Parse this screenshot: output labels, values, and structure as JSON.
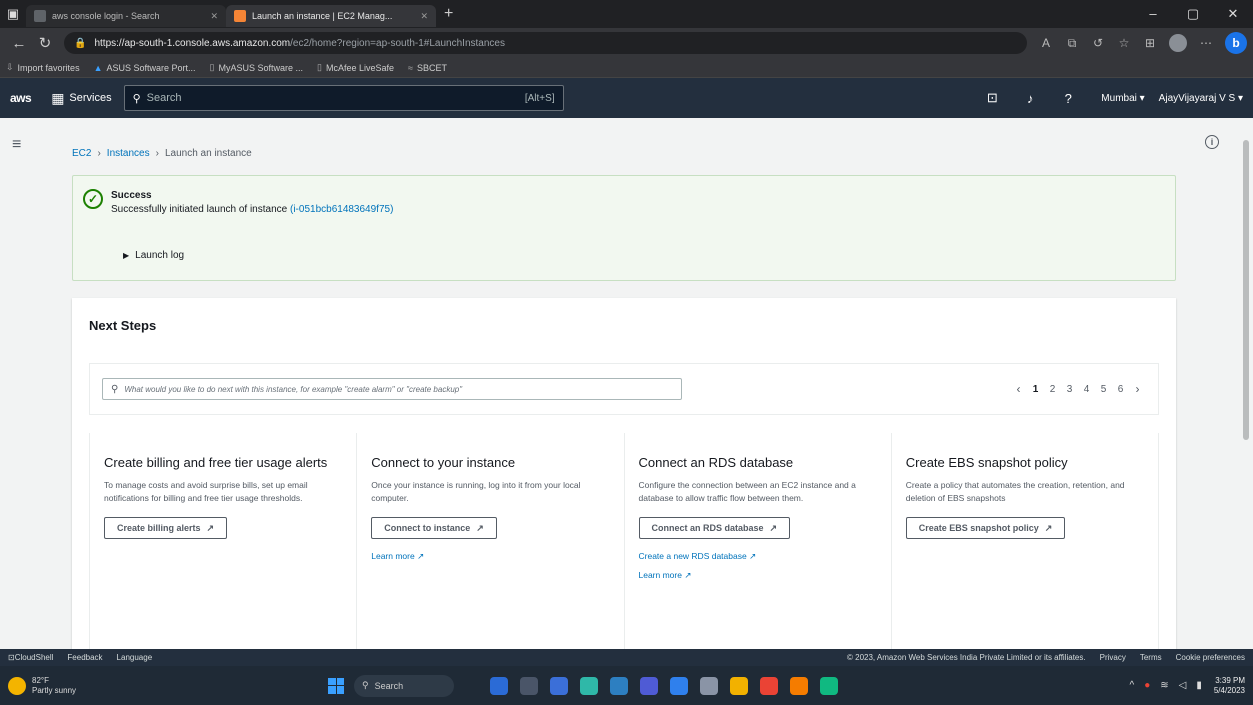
{
  "browser": {
    "tabs": [
      {
        "title": "aws console login - Search",
        "favicon_color": "#5f6368",
        "active": false
      },
      {
        "title": "Launch an instance | EC2 Manag...",
        "favicon_color": "#f58536",
        "active": true
      }
    ],
    "new_tab_glyph": "+",
    "url_host": "https://ap-south-1.console.aws.amazon.com",
    "url_path": "/ec2/home?region=ap-south-1#LaunchInstances",
    "bookmarks": [
      "Import favorites",
      "ASUS Software Port...",
      "MyASUS Software ...",
      "McAfee LiveSafe",
      "SBCET"
    ]
  },
  "aws_nav": {
    "logo": "aws",
    "services_label": "Services",
    "search_placeholder": "Search",
    "search_shortcut": "[Alt+S]",
    "region": "Mumbai ▾",
    "account": "AjayVijayaraj V S ▾"
  },
  "breadcrumb": {
    "ec2": "EC2",
    "instances": "Instances",
    "current": "Launch an instance"
  },
  "alert": {
    "title": "Success",
    "message": "Successfully initiated launch of instance",
    "instance_id": "(i-051bcb61483649f75)",
    "log_label": "Launch log"
  },
  "next_steps": {
    "heading": "Next Steps",
    "filter_placeholder": "What would you like to do next with this instance, for example \"create alarm\" or \"create backup\"",
    "pages": [
      "1",
      "2",
      "3",
      "4",
      "5",
      "6"
    ],
    "current_page": "1",
    "cards": [
      {
        "title": "Create billing and free tier usage alerts",
        "desc": "To manage costs and avoid surprise bills, set up email notifications for billing and free tier usage thresholds.",
        "button": "Create billing alerts"
      },
      {
        "title": "Connect to your instance",
        "desc": "Once your instance is running, log into it from your local computer.",
        "button": "Connect to instance",
        "link1": "Learn more"
      },
      {
        "title": "Connect an RDS database",
        "desc": "Configure the connection between an EC2 instance and a database to allow traffic flow between them.",
        "button": "Connect an RDS database",
        "link1": "Create a new RDS database",
        "link2": "Learn more"
      },
      {
        "title": "Create EBS snapshot policy",
        "desc": "Create a policy that automates the creation, retention, and deletion of EBS snapshots",
        "button": "Create EBS snapshot policy"
      }
    ]
  },
  "footer": {
    "cloudshell": "CloudShell",
    "feedback": "Feedback",
    "language": "Language",
    "copyright": "© 2023, Amazon Web Services India Private Limited or its affiliates.",
    "privacy": "Privacy",
    "terms": "Terms",
    "cookies": "Cookie preferences"
  },
  "taskbar": {
    "temp": "82°F",
    "weather": "Partly sunny",
    "search": "Search",
    "time": "3:39 PM",
    "date": "5/4/2023",
    "app_colors": [
      "#2b6bd6",
      "#4a5568",
      "#3b6fd8",
      "#2fb8a8",
      "#2d7fc1",
      "#4f5bd5",
      "#2f80ed",
      "#8a94a6",
      "#f2b100",
      "#ea4335",
      "#f57c00",
      "#10b981"
    ]
  },
  "colors": {
    "aws_nav_bg": "#232f3e",
    "link": "#0073bb",
    "success": "#1d8102"
  }
}
